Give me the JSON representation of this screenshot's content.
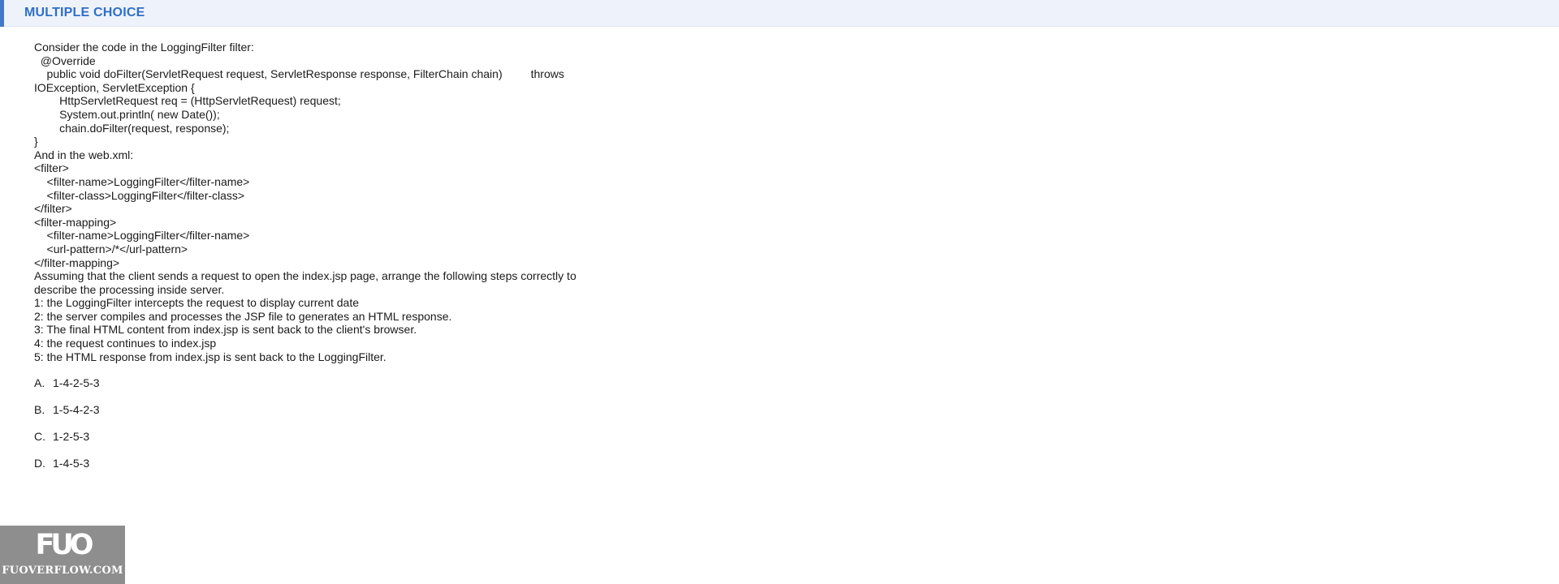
{
  "section": {
    "title": "MULTIPLE CHOICE"
  },
  "question": {
    "lines": [
      "Consider the code in the LoggingFilter filter:",
      "  @Override",
      "    public void doFilter(ServletRequest request, ServletResponse response, FilterChain chain)         throws",
      "IOException, ServletException {",
      "        HttpServletRequest req = (HttpServletRequest) request;",
      "        System.out.println( new Date());",
      "        chain.doFilter(request, response);",
      "}",
      "And in the web.xml:",
      "<filter>",
      "    <filter-name>LoggingFilter</filter-name>",
      "    <filter-class>LoggingFilter</filter-class>",
      "</filter>",
      "<filter-mapping>",
      "    <filter-name>LoggingFilter</filter-name>",
      "    <url-pattern>/*</url-pattern>",
      "</filter-mapping>",
      "Assuming that the client sends a request to open the index.jsp page, arrange the following steps correctly to",
      "describe the processing inside server.",
      "1: the LoggingFilter intercepts the request to display current date",
      "2: the server compiles and processes the JSP file to generates an HTML response.",
      "3: The final HTML content from index.jsp is sent back to the client's browser.",
      "4: the request continues to index.jsp",
      "5: the HTML response from index.jsp is sent back to the LoggingFilter."
    ]
  },
  "options": [
    {
      "letter": "A.",
      "text": "1-4-2-5-3"
    },
    {
      "letter": "B.",
      "text": "1-5-4-2-3"
    },
    {
      "letter": "C.",
      "text": "1-2-5-3"
    },
    {
      "letter": "D.",
      "text": "1-4-5-3"
    }
  ],
  "watermark": {
    "logo": "FUO",
    "site": "FUOVERFLOW.COM"
  },
  "colors": {
    "accent": "#3f78cc",
    "header_bg": "#eef3fb",
    "title": "#2f6fc6",
    "watermark_bg": "#8e8e8e"
  }
}
